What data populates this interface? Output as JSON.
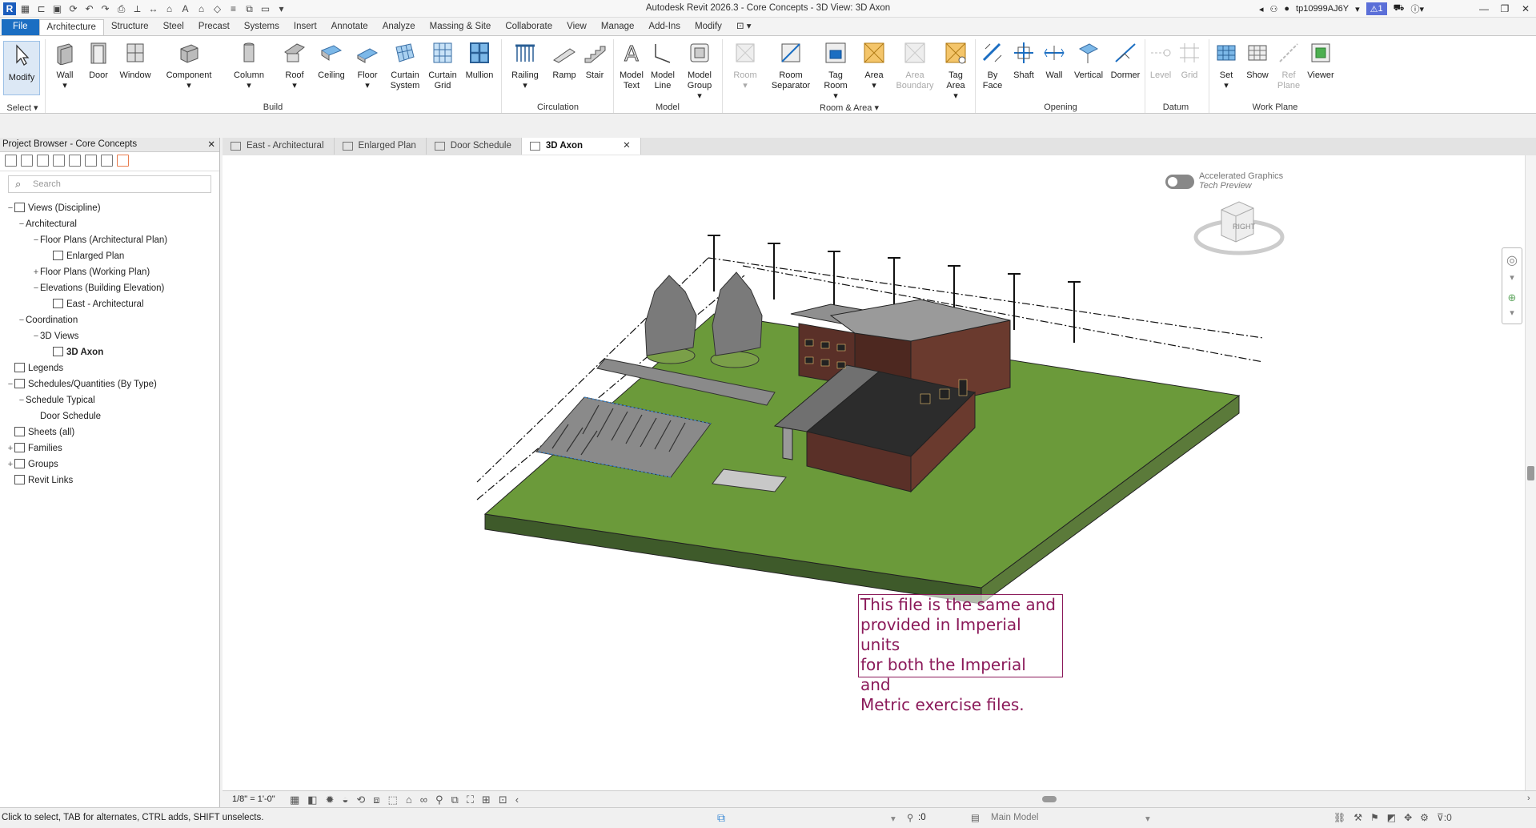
{
  "window": {
    "title": "Autodesk Revit 2026.3 - Core Concepts - 3D View: 3D Axon",
    "username": "tp10999AJ6Y",
    "alerts_count": "1"
  },
  "ribbon_tabs": [
    "File",
    "Architecture",
    "Structure",
    "Steel",
    "Precast",
    "Systems",
    "Insert",
    "Annotate",
    "Analyze",
    "Massing & Site",
    "Collaborate",
    "View",
    "Manage",
    "Add-Ins",
    "Modify"
  ],
  "ribbon": {
    "select_label": "Select",
    "modify": "Modify",
    "build": {
      "label": "Build",
      "items": [
        "Wall",
        "Door",
        "Window",
        "Component",
        "Column",
        "Roof",
        "Ceiling",
        "Floor",
        "Curtain System",
        "Curtain Grid",
        "Mullion"
      ]
    },
    "circulation": {
      "label": "Circulation",
      "items": [
        "Railing",
        "Ramp",
        "Stair"
      ]
    },
    "model": {
      "label": "Model",
      "items": [
        "Model Text",
        "Model Line",
        "Model Group"
      ]
    },
    "room_area": {
      "label": "Room & Area",
      "items": [
        "Room",
        "Room Separator",
        "Tag Room",
        "Area",
        "Area Boundary",
        "Tag Area"
      ]
    },
    "opening": {
      "label": "Opening",
      "items": [
        "By Face",
        "Shaft",
        "Wall",
        "Vertical",
        "Dormer"
      ]
    },
    "datum": {
      "label": "Datum",
      "items": [
        "Level",
        "Grid"
      ]
    },
    "work_plane": {
      "label": "Work Plane",
      "items": [
        "Set",
        "Show",
        "Ref Plane",
        "Viewer"
      ]
    }
  },
  "project_browser": {
    "title": "Project Browser - Core Concepts",
    "search_placeholder": "Search",
    "tree": [
      {
        "label": "Views (Discipline)",
        "depth": 0,
        "exp": "−"
      },
      {
        "label": "Architectural",
        "depth": 1,
        "exp": "−"
      },
      {
        "label": "Floor Plans (Architectural Plan)",
        "depth": 2,
        "exp": "−"
      },
      {
        "label": "Enlarged Plan",
        "depth": 3,
        "exp": ""
      },
      {
        "label": "Floor Plans (Working Plan)",
        "depth": 2,
        "exp": "+"
      },
      {
        "label": "Elevations (Building Elevation)",
        "depth": 2,
        "exp": "−"
      },
      {
        "label": "East - Architectural",
        "depth": 3,
        "exp": ""
      },
      {
        "label": "Coordination",
        "depth": 1,
        "exp": "−"
      },
      {
        "label": "3D Views",
        "depth": 2,
        "exp": "−"
      },
      {
        "label": "3D Axon",
        "depth": 3,
        "exp": "",
        "bold": true
      },
      {
        "label": "Legends",
        "depth": 0,
        "exp": ""
      },
      {
        "label": "Schedules/Quantities (By Type)",
        "depth": 0,
        "exp": "−"
      },
      {
        "label": "Schedule Typical",
        "depth": 1,
        "exp": "−"
      },
      {
        "label": "Door Schedule",
        "depth": 2,
        "exp": ""
      },
      {
        "label": "Sheets (all)",
        "depth": 0,
        "exp": ""
      },
      {
        "label": "Families",
        "depth": 0,
        "exp": "+"
      },
      {
        "label": "Groups",
        "depth": 0,
        "exp": "+"
      },
      {
        "label": "Revit Links",
        "depth": 0,
        "exp": ""
      }
    ]
  },
  "view_tabs": [
    "East - Architectural",
    "Enlarged Plan",
    "Door Schedule",
    "3D Axon"
  ],
  "canvas": {
    "accel_line1": "Accelerated Graphics",
    "accel_line2": "Tech Preview",
    "viewcube_face": "RIGHT",
    "note_lines": [
      "This file is the same and",
      "provided in Imperial units",
      "for both the Imperial and",
      "Metric exercise files."
    ]
  },
  "view_bar": {
    "scale": "1/8\" = 1'-0\""
  },
  "status_bar": {
    "hint": "Click to select, TAB for alternates, CTRL adds, SHIFT unselects.",
    "coord_value": ":0",
    "model": "Main Model",
    "filter_count": ":0"
  },
  "colors": {
    "accent": "#1b6ec2",
    "grass": "#6b9a3a",
    "note_text": "#8b1a5a"
  }
}
